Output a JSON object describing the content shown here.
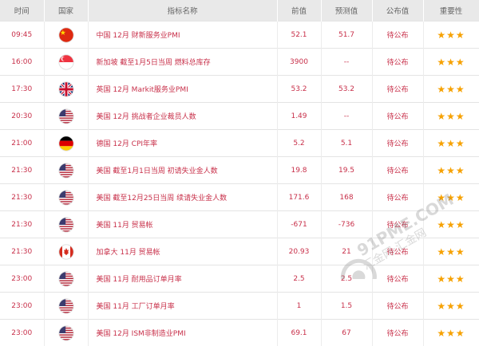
{
  "columns": {
    "time": "时间",
    "country": "国家",
    "name": "指标名称",
    "previous": "前值",
    "forecast": "预测值",
    "actual": "公布值",
    "importance": "重要性"
  },
  "rows": [
    {
      "time": "09:45",
      "flag": "cn",
      "flag_icon": "china-flag-icon",
      "name": "中国 12月 财新服务业PMI",
      "previous": "52.1",
      "forecast": "51.7",
      "actual": "待公布",
      "stars": "★★★"
    },
    {
      "time": "16:00",
      "flag": "sg",
      "flag_icon": "singapore-flag-icon",
      "name": "新加坡 截至1月5日当周 燃料总库存",
      "previous": "3900",
      "forecast": "--",
      "actual": "待公布",
      "stars": "★★★"
    },
    {
      "time": "17:30",
      "flag": "gb",
      "flag_icon": "uk-flag-icon",
      "name": "英国 12月 Markit服务业PMI",
      "previous": "53.2",
      "forecast": "53.2",
      "actual": "待公布",
      "stars": "★★★"
    },
    {
      "time": "20:30",
      "flag": "us",
      "flag_icon": "us-flag-icon",
      "name": "美国 12月 挑战者企业裁员人数",
      "previous": "1.49",
      "forecast": "--",
      "actual": "待公布",
      "stars": "★★★"
    },
    {
      "time": "21:00",
      "flag": "de",
      "flag_icon": "germany-flag-icon",
      "name": "德国 12月 CPI年率",
      "previous": "5.2",
      "forecast": "5.1",
      "actual": "待公布",
      "stars": "★★★"
    },
    {
      "time": "21:30",
      "flag": "us",
      "flag_icon": "us-flag-icon",
      "name": "美国 截至1月1日当周 初请失业金人数",
      "previous": "19.8",
      "forecast": "19.5",
      "actual": "待公布",
      "stars": "★★★"
    },
    {
      "time": "21:30",
      "flag": "us",
      "flag_icon": "us-flag-icon",
      "name": "美国 截至12月25日当周 续请失业金人数",
      "previous": "171.6",
      "forecast": "168",
      "actual": "待公布",
      "stars": "★★★"
    },
    {
      "time": "21:30",
      "flag": "us",
      "flag_icon": "us-flag-icon",
      "name": "美国 11月 贸易帐",
      "previous": "-671",
      "forecast": "-736",
      "actual": "待公布",
      "stars": "★★★"
    },
    {
      "time": "21:30",
      "flag": "ca",
      "flag_icon": "canada-flag-icon",
      "name": "加拿大 11月 贸易帐",
      "previous": "20.93",
      "forecast": "21",
      "actual": "待公布",
      "stars": "★★★"
    },
    {
      "time": "23:00",
      "flag": "us",
      "flag_icon": "us-flag-icon",
      "name": "美国 11月 耐用品订单月率",
      "previous": "2.5",
      "forecast": "2.5",
      "actual": "待公布",
      "stars": "★★★"
    },
    {
      "time": "23:00",
      "flag": "us",
      "flag_icon": "us-flag-icon",
      "name": "美国 11月 工厂订单月率",
      "previous": "1",
      "forecast": "1.5",
      "actual": "待公布",
      "stars": "★★★"
    },
    {
      "time": "23:00",
      "flag": "us",
      "flag_icon": "us-flag-icon",
      "name": "美国 12月 ISM非制造业PMI",
      "previous": "69.1",
      "forecast": "67",
      "actual": "待公布",
      "stars": "★★★"
    }
  ],
  "watermark": {
    "brand": "91PME.COM",
    "subtitle": "汇金网·汇金网"
  },
  "colors": {
    "text": "#c8304a",
    "header_bg": "#e9e9e9",
    "star": "#f6a100"
  }
}
